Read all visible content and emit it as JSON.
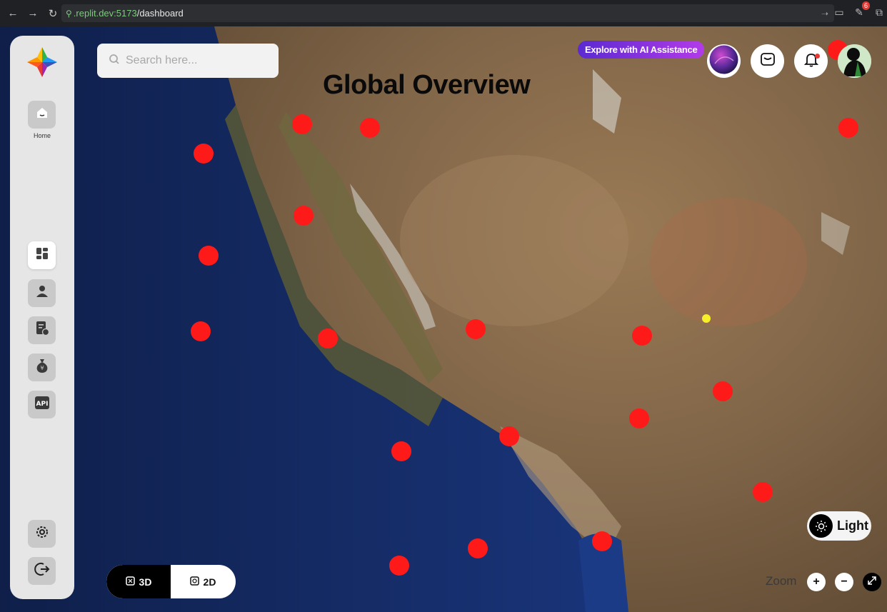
{
  "browser": {
    "url_host": ".replit.dev:5173",
    "url_path": "/dashboard",
    "extensions_badge": "6"
  },
  "sidebar": {
    "home_label": "Home",
    "items": [
      {
        "icon": "dashboard-icon",
        "active": true
      },
      {
        "icon": "user-icon",
        "active": false
      },
      {
        "icon": "report-icon",
        "active": false
      },
      {
        "icon": "money-bag-icon",
        "active": false
      },
      {
        "icon": "api-icon",
        "label": "API",
        "active": false
      }
    ],
    "bottom": [
      {
        "icon": "gear-icon"
      },
      {
        "icon": "logout-icon"
      }
    ]
  },
  "search": {
    "placeholder": "Search here..."
  },
  "header": {
    "title": "Global Overview",
    "ai_button": "Explore with AI Assistance"
  },
  "view_toggle": {
    "options": [
      "3D",
      "2D"
    ],
    "selected": "3D"
  },
  "theme": {
    "label": "Light"
  },
  "zoom": {
    "label": "Zoom",
    "in": "+",
    "out": "−"
  },
  "map": {
    "marker_color": "#ff1a1a",
    "highlight_color": "#f5f02a",
    "marker_count": 22
  }
}
